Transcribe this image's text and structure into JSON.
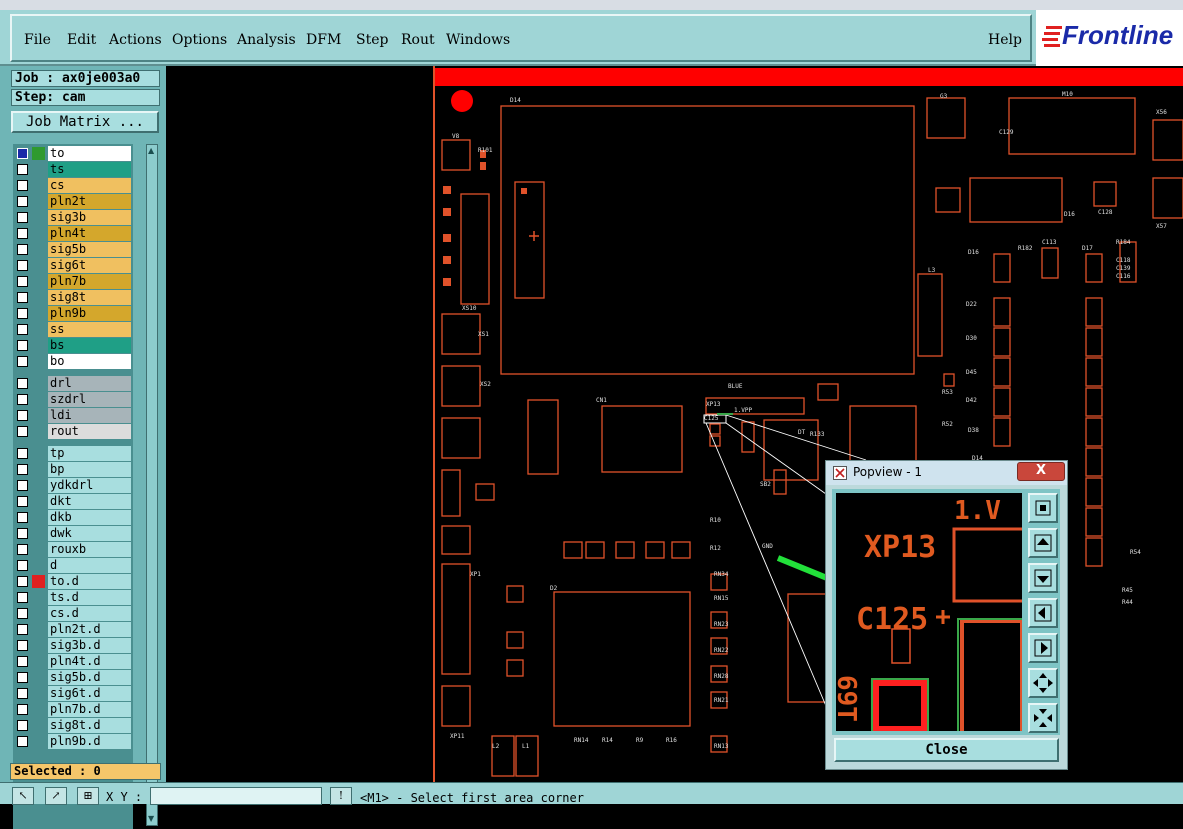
{
  "menu": {
    "items": [
      "File",
      "Edit",
      "Actions",
      "Options",
      "Analysis",
      "DFM",
      "Step",
      "Rout",
      "Windows"
    ],
    "help": "Help",
    "logo": "Frontline"
  },
  "panel": {
    "job": "Job : ax0je003a0",
    "step": "Step: cam",
    "job_matrix": "Job Matrix ...",
    "selected": "Selected : 0"
  },
  "layers": [
    {
      "name": "to",
      "color": "#ffffff",
      "swatch": "#2f9a2f",
      "selected": true
    },
    {
      "name": "ts",
      "color": "#1f9f86"
    },
    {
      "name": "cs",
      "color": "#f0c060"
    },
    {
      "name": "pln2t",
      "color": "#d4a72c"
    },
    {
      "name": "sig3b",
      "color": "#f0c060"
    },
    {
      "name": "pln4t",
      "color": "#d4a72c"
    },
    {
      "name": "sig5b",
      "color": "#f0c060"
    },
    {
      "name": "sig6t",
      "color": "#f0c060"
    },
    {
      "name": "pln7b",
      "color": "#d4a72c"
    },
    {
      "name": "sig8t",
      "color": "#f0c060"
    },
    {
      "name": "pln9b",
      "color": "#d4a72c"
    },
    {
      "name": "ss",
      "color": "#f0c060"
    },
    {
      "name": "bs",
      "color": "#1f9f86"
    },
    {
      "name": "bo",
      "color": "#ffffff"
    },
    {
      "name": "drl",
      "color": "#a7b4b9"
    },
    {
      "name": "szdrl",
      "color": "#a7b4b9"
    },
    {
      "name": "ldi",
      "color": "#a7b4b9"
    },
    {
      "name": "rout",
      "color": "#dcdcdc"
    },
    {
      "name": "tp",
      "color": "#a8dedf"
    },
    {
      "name": "bp",
      "color": "#a8dedf"
    },
    {
      "name": "ydkdrl",
      "color": "#a8dedf"
    },
    {
      "name": "dkt",
      "color": "#a8dedf"
    },
    {
      "name": "dkb",
      "color": "#a8dedf"
    },
    {
      "name": "dwk",
      "color": "#a8dedf"
    },
    {
      "name": "rouxb",
      "color": "#a8dedf"
    },
    {
      "name": "d",
      "color": "#a8dedf"
    },
    {
      "name": "to.d",
      "color": "#a8dedf",
      "swatch": "#e02020"
    },
    {
      "name": "ts.d",
      "color": "#a8dedf"
    },
    {
      "name": "cs.d",
      "color": "#a8dedf"
    },
    {
      "name": "pln2t.d",
      "color": "#a8dedf"
    },
    {
      "name": "sig3b.d",
      "color": "#a8dedf"
    },
    {
      "name": "pln4t.d",
      "color": "#a8dedf"
    },
    {
      "name": "sig5b.d",
      "color": "#a8dedf"
    },
    {
      "name": "sig6t.d",
      "color": "#a8dedf"
    },
    {
      "name": "pln7b.d",
      "color": "#a8dedf"
    },
    {
      "name": "sig8t.d",
      "color": "#a8dedf"
    },
    {
      "name": "pln9b.d",
      "color": "#a8dedf"
    }
  ],
  "status": {
    "xy_label": "X Y :",
    "message": "<M1> - Select first area corner"
  },
  "popview": {
    "title": "Popview - 1",
    "close_x": "X",
    "close_button": "Close",
    "labels": {
      "xp13": "XP13",
      "c125": "C125",
      "vp": "1.V",
      "bottom": "69T"
    }
  },
  "pcb_labels": [
    "D14",
    "G3",
    "M10",
    "X56",
    "V8",
    "R101",
    "C129",
    "D16",
    "C128",
    "X57",
    "L3",
    "D16",
    "R182",
    "C113",
    "D17",
    "R184",
    "C118",
    "C139",
    "D22",
    "C116",
    "D30",
    "D45",
    "D42",
    "D38",
    "D14",
    "R53",
    "R52",
    "XS10",
    "XS1",
    "XS2",
    "BLUE",
    "XP13",
    "1.VPP",
    "CN1",
    "C125",
    "R133",
    "DT",
    "SB2",
    "GND",
    "R10",
    "R12",
    "D2",
    "RN34",
    "RN15",
    "RN23",
    "RN22",
    "RN28",
    "RN21",
    "RN13",
    "RN14",
    "R14",
    "R9",
    "R16",
    "L2",
    "L1",
    "XP11",
    "XP1",
    "R45",
    "R44",
    "R54"
  ],
  "colors": {
    "accent": "#9fd5d6",
    "pcb_trace": "#e0522a",
    "pcb_green": "#3aa84a",
    "highlight": "#ff0000"
  }
}
